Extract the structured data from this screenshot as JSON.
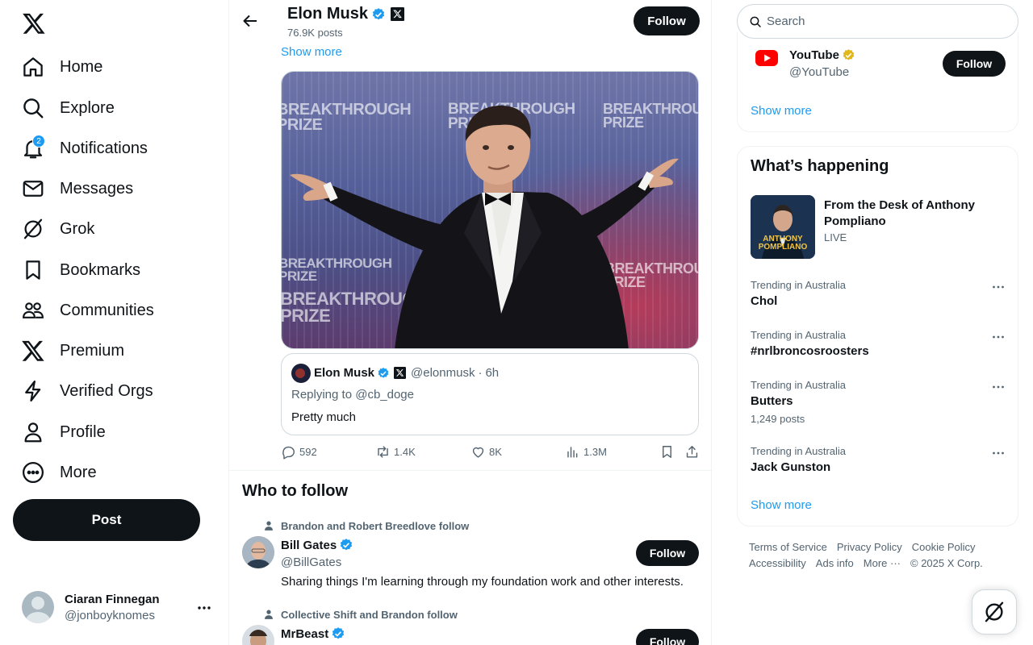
{
  "nav": {
    "items": [
      {
        "label": "Home",
        "icon": "home-icon"
      },
      {
        "label": "Explore",
        "icon": "search-icon"
      },
      {
        "label": "Notifications",
        "icon": "bell-icon",
        "badge": "2"
      },
      {
        "label": "Messages",
        "icon": "envelope-icon"
      },
      {
        "label": "Grok",
        "icon": "grok-icon"
      },
      {
        "label": "Bookmarks",
        "icon": "bookmark-icon"
      },
      {
        "label": "Communities",
        "icon": "people-icon"
      },
      {
        "label": "Premium",
        "icon": "x-logo-icon"
      },
      {
        "label": "Verified Orgs",
        "icon": "lightning-icon"
      },
      {
        "label": "Profile",
        "icon": "person-icon"
      },
      {
        "label": "More",
        "icon": "more-circle-icon"
      }
    ],
    "post_label": "Post"
  },
  "account": {
    "name": "Ciaran Finnegan",
    "handle": "@jonboyknomes"
  },
  "header": {
    "name": "Elon Musk",
    "posts": "76.9K posts",
    "follow_label": "Follow"
  },
  "tweet": {
    "show_more": "Show more",
    "photo_watermark": "BREAKTHROUGH PRIZE",
    "quote": {
      "name": "Elon Musk",
      "handle": "@elonmusk",
      "time": "6h",
      "replying": "Replying to @cb_doge",
      "text": "Pretty much"
    },
    "stats": {
      "replies": "592",
      "reposts": "1.4K",
      "likes": "8K",
      "views": "1.3M"
    }
  },
  "who_to_follow": {
    "title": "Who to follow",
    "people": [
      {
        "context": "Brandon and Robert Breedlove follow",
        "name": "Bill Gates",
        "handle": "@BillGates",
        "bio": "Sharing things I'm learning through my foundation work and other interests.",
        "follow_label": "Follow"
      },
      {
        "context": "Collective Shift and Brandon follow",
        "name": "MrBeast",
        "follow_label": "Follow"
      }
    ]
  },
  "right": {
    "search_placeholder": "Search",
    "suggested": {
      "name": "YouTube",
      "handle": "@YouTube",
      "follow_label": "Follow"
    },
    "show_more": "Show more",
    "happening": {
      "title": "What’s happening",
      "podcast": {
        "title": "From the Desk of Anthony Pompliano",
        "status": "LIVE",
        "thumb_text": "ANTHONY POMPLIANO"
      },
      "trends": [
        {
          "context": "Trending in Australia",
          "topic": "Chol",
          "posts": ""
        },
        {
          "context": "Trending in Australia",
          "topic": "#nrlbroncosroosters",
          "posts": ""
        },
        {
          "context": "Trending in Australia",
          "topic": "Butters",
          "posts": "1,249 posts"
        },
        {
          "context": "Trending in Australia",
          "topic": "Jack Gunston",
          "posts": ""
        }
      ],
      "show_more": "Show more"
    },
    "footer": {
      "links": [
        "Terms of Service",
        "Privacy Policy",
        "Cookie Policy",
        "Accessibility",
        "Ads info",
        "More ···"
      ],
      "copyright": "© 2025 X Corp."
    }
  },
  "colors": {
    "accent": "#1d9bf0",
    "text": "#0f1419",
    "muted": "#536471",
    "gold": "#e2b719"
  }
}
